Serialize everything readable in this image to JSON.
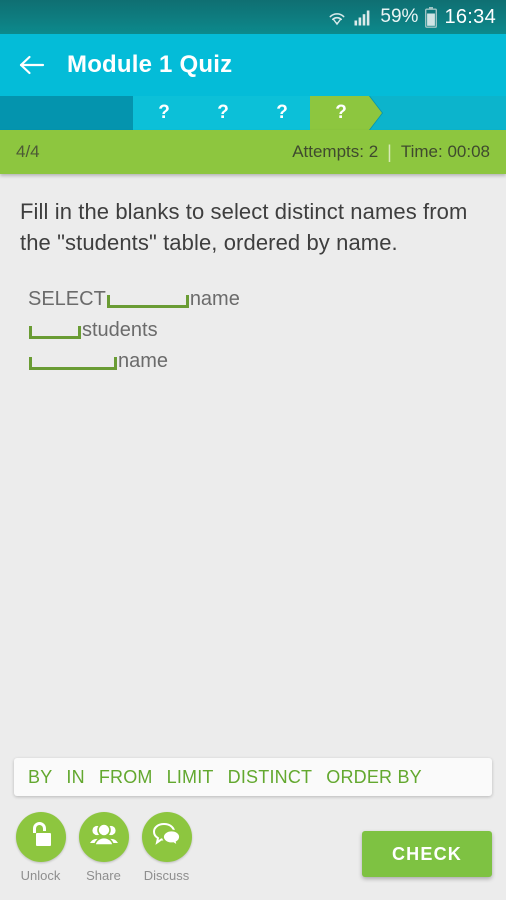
{
  "status_bar": {
    "wifi_icon": "wifi-icon",
    "signal_icon": "signal-bars-icon",
    "battery_percent": "59%",
    "battery_icon": "battery-icon",
    "clock": "16:34"
  },
  "app_bar": {
    "back_icon": "back-arrow-icon",
    "title": "Module 1 Quiz"
  },
  "progress": {
    "steps": [
      {
        "label": "?",
        "state": "pending"
      },
      {
        "label": "?",
        "state": "pending"
      },
      {
        "label": "?",
        "state": "pending"
      },
      {
        "label": "?",
        "state": "current"
      }
    ],
    "active_color": "#8dc63f",
    "pending_color": "#0cc0d8"
  },
  "stats": {
    "position": "4/4",
    "attempts": "Attempts: 2",
    "separator": "|",
    "time": "Time: 00:08"
  },
  "question": {
    "prompt": "Fill in the blanks to select distinct names from the \"students\" table, ordered by name.",
    "code_lines": [
      {
        "prefix": "SELECT ",
        "blank": "long",
        "suffix": " name"
      },
      {
        "prefix": "",
        "blank": "short",
        "suffix": " students"
      },
      {
        "prefix": "",
        "blank": "med",
        "suffix": " name"
      }
    ]
  },
  "word_bank": {
    "words": [
      "BY",
      "IN",
      "FROM",
      "LIMIT",
      "DISTINCT",
      "ORDER BY"
    ],
    "word_color": "#63a82f"
  },
  "actions": [
    {
      "label": "Unlock",
      "icon": "unlock-padlock-icon"
    },
    {
      "label": "Share",
      "icon": "people-group-icon"
    },
    {
      "label": "Discuss",
      "icon": "speech-bubbles-icon"
    }
  ],
  "check_button": {
    "label": "CHECK",
    "color": "#7ec242"
  }
}
